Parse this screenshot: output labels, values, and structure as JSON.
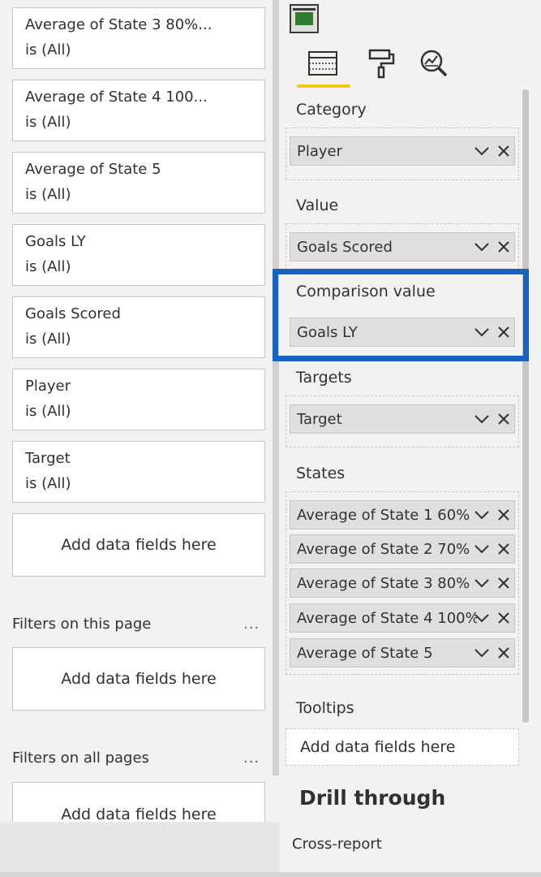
{
  "filters_pane": {
    "cards": [
      {
        "name": "Average of State 3 80%...",
        "state": "is (All)"
      },
      {
        "name": "Average of State 4 100...",
        "state": "is (All)"
      },
      {
        "name": "Average of State 5",
        "state": "is (All)"
      },
      {
        "name": "Goals LY",
        "state": "is (All)"
      },
      {
        "name": "Goals Scored",
        "state": "is (All)"
      },
      {
        "name": "Player",
        "state": "is (All)"
      },
      {
        "name": "Target",
        "state": "is (All)"
      }
    ],
    "visual_add_label": "Add data fields here",
    "page_filters": {
      "title": "Filters on this page",
      "more": "...",
      "add_label": "Add data fields here"
    },
    "all_filters": {
      "title": "Filters on all pages",
      "more": "...",
      "add_label": "Add data fields here"
    }
  },
  "viz_pane": {
    "tabs": [
      {
        "icon": "fields-icon",
        "active": true
      },
      {
        "icon": "format-paint-roller-icon",
        "active": false
      },
      {
        "icon": "analytics-magnifier-icon",
        "active": false
      }
    ],
    "accent_color": "#f2c811",
    "highlight_color": "#1565c0",
    "wells": {
      "category": {
        "title": "Category",
        "fields": [
          "Player"
        ]
      },
      "value": {
        "title": "Value",
        "fields": [
          "Goals Scored"
        ]
      },
      "comparison": {
        "title": "Comparison value",
        "fields": [
          "Goals LY"
        ]
      },
      "targets": {
        "title": "Targets",
        "fields": [
          "Target"
        ]
      },
      "states": {
        "title": "States",
        "fields": [
          "Average of State 1 60%",
          "Average of State 2 70%",
          "Average of State 3 80%",
          "Average of State 4 100%",
          "Average of State 5"
        ]
      },
      "tooltips": {
        "title": "Tooltips",
        "add_label": "Add data fields here"
      }
    },
    "drill_through": {
      "title": "Drill through",
      "cross_report": "Cross-report"
    }
  }
}
